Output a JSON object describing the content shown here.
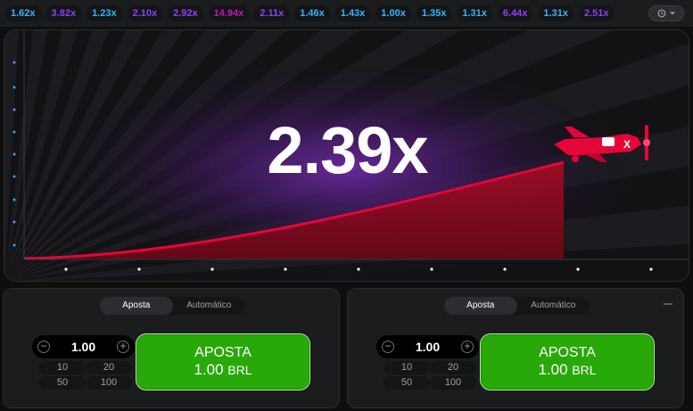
{
  "history": [
    {
      "value": "1.62x",
      "tone": "blue"
    },
    {
      "value": "3.82x",
      "tone": "purple"
    },
    {
      "value": "1.23x",
      "tone": "blue"
    },
    {
      "value": "2.10x",
      "tone": "purple"
    },
    {
      "value": "2.92x",
      "tone": "purple"
    },
    {
      "value": "14.94x",
      "tone": "pink"
    },
    {
      "value": "2.11x",
      "tone": "purple"
    },
    {
      "value": "1.46x",
      "tone": "blue"
    },
    {
      "value": "1.43x",
      "tone": "blue"
    },
    {
      "value": "1.00x",
      "tone": "blue"
    },
    {
      "value": "1.35x",
      "tone": "blue"
    },
    {
      "value": "1.31x",
      "tone": "blue"
    },
    {
      "value": "6.44x",
      "tone": "purple"
    },
    {
      "value": "1.31x",
      "tone": "blue"
    },
    {
      "value": "2.51x",
      "tone": "purple"
    }
  ],
  "history_button": {
    "icon": "history-icon",
    "caret": "chevron-down-icon"
  },
  "game": {
    "multiplier": "2.39x",
    "plane_icon": "plane-icon",
    "colors": {
      "curve": "#e50539",
      "fill": "#8e0a1e",
      "glow": "#5b1a8a"
    }
  },
  "panels": [
    {
      "tabs": [
        "Aposta",
        "Automático"
      ],
      "active_tab": "Aposta",
      "stake": "1.00",
      "quick_amounts": [
        "10",
        "20",
        "50",
        "100"
      ],
      "bet_label": "APOSTA",
      "bet_amount": "1.00",
      "currency": "BRL"
    },
    {
      "tabs": [
        "Aposta",
        "Automático"
      ],
      "active_tab": "Aposta",
      "stake": "1.00",
      "quick_amounts": [
        "10",
        "20",
        "50",
        "100"
      ],
      "bet_label": "APOSTA",
      "bet_amount": "1.00",
      "currency": "BRL"
    }
  ]
}
